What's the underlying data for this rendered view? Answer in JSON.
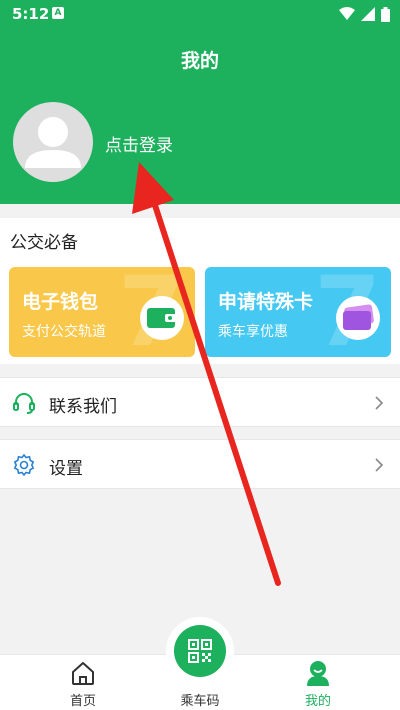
{
  "status": {
    "time": "5:12",
    "badge": "A"
  },
  "header": {
    "title": "我的",
    "login": "点击登录"
  },
  "section": {
    "title": "公交必备",
    "cards": [
      {
        "title": "电子钱包",
        "subtitle": "支付公交轨道"
      },
      {
        "title": "申请特殊卡",
        "subtitle": "乘车享优惠"
      }
    ]
  },
  "rows": {
    "contact": "联系我们",
    "settings": "设置"
  },
  "tabs": {
    "home": "首页",
    "ride": "乘车码",
    "mine": "我的"
  },
  "icons": [
    "wifi-icon",
    "signal-icon",
    "battery-icon",
    "user-avatar-icon",
    "wallet-icon",
    "card-icon",
    "headset-icon",
    "gear-icon",
    "chevron-right-icon",
    "home-icon",
    "qr-code-icon",
    "person-icon"
  ],
  "colors": {
    "brand_green": "#1db15e",
    "wallet_yellow": "#f9c84a",
    "special_blue": "#45c8f2",
    "annotation_red": "#e8261f"
  }
}
